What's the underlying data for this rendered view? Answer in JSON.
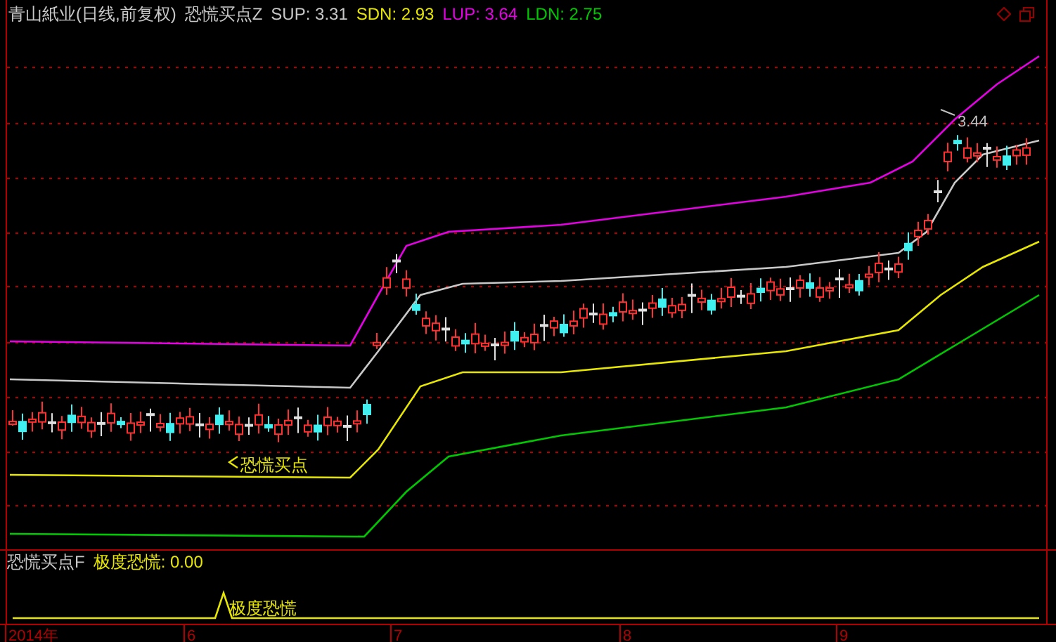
{
  "main_panel": {
    "stock_title": "青山紙业(日线,前复权)",
    "indicator_name": "恐慌买点Z",
    "readings": [
      {
        "text": "SUP: 3.31",
        "color": "#c8c8c8"
      },
      {
        "text": "SDN: 2.93",
        "color": "#e6e600"
      },
      {
        "text": "LUP: 3.64",
        "color": "#e600e6"
      },
      {
        "text": "LDN: 2.75",
        "color": "#00c800"
      }
    ],
    "annotations": [
      {
        "kind": "high",
        "text": "3.44"
      },
      {
        "kind": "signal",
        "text": "恐慌买点"
      }
    ]
  },
  "lower_panel": {
    "indicator_name": "恐慌买点F",
    "reading": "极度恐慌: 0.00",
    "annotation": "极度恐慌"
  },
  "x_axis": {
    "labels": [
      "2014年",
      "6",
      "7",
      "8",
      "9"
    ]
  }
}
